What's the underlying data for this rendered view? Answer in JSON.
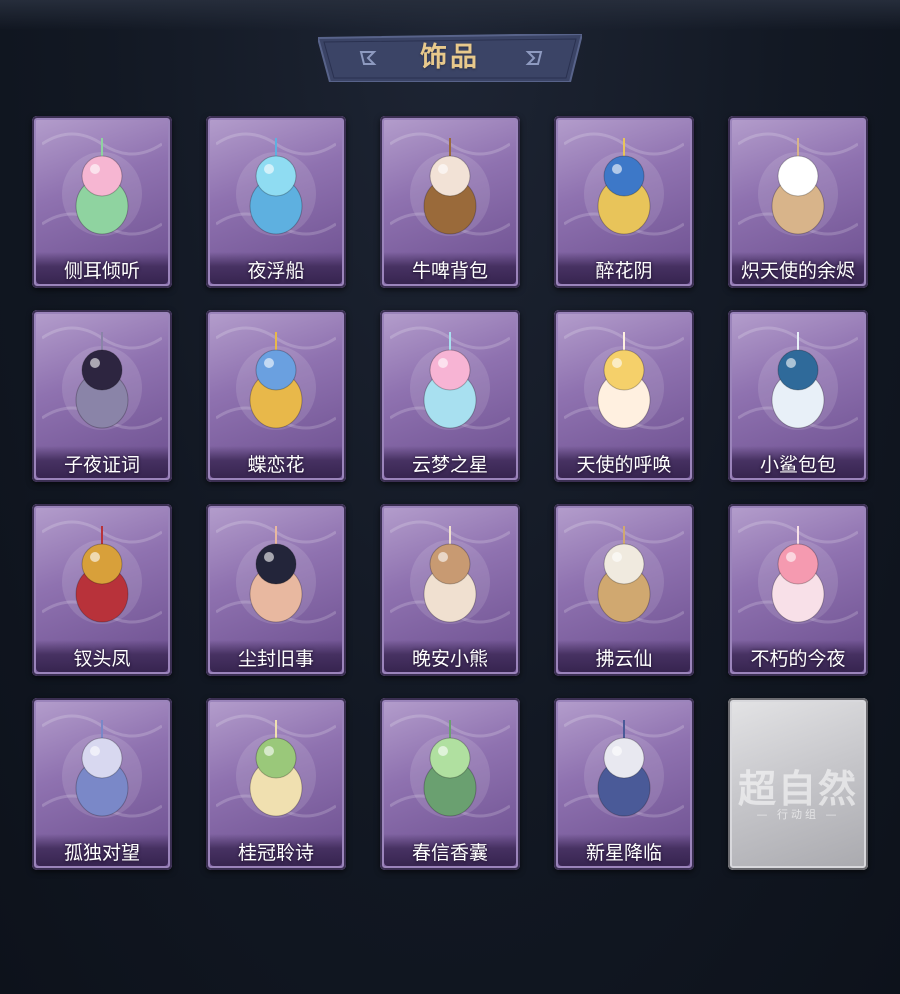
{
  "header": {
    "title": "饰品"
  },
  "colors": {
    "background": "#121823",
    "card_purple": "#8f72b0",
    "card_locked": "#c8c8cc",
    "banner": "#3b4466",
    "title_gold": "#e8c98c"
  },
  "accessories": [
    {
      "name": "侧耳倾听",
      "icon": "lotus-moon-ornament-icon"
    },
    {
      "name": "夜浮船",
      "icon": "jellyfish-ornament-icon"
    },
    {
      "name": "牛啤背包",
      "icon": "cow-beer-mug-icon"
    },
    {
      "name": "醉花阴",
      "icon": "blue-flower-fan-icon"
    },
    {
      "name": "炽天使的余烬",
      "icon": "angel-girl-figure-icon"
    },
    {
      "name": "子夜证词",
      "icon": "owl-plague-doctor-icon"
    },
    {
      "name": "蝶恋花",
      "icon": "butterfly-bell-wreath-icon"
    },
    {
      "name": "云梦之星",
      "icon": "rainbow-unicorn-icon"
    },
    {
      "name": "天使的呼唤",
      "icon": "halo-angel-icon"
    },
    {
      "name": "小鲨包包",
      "icon": "shark-bag-icon"
    },
    {
      "name": "钗头凤",
      "icon": "phoenix-crown-doll-icon"
    },
    {
      "name": "尘封旧事",
      "icon": "gentleman-doll-icon"
    },
    {
      "name": "晚安小熊",
      "icon": "teddy-bear-charm-icon"
    },
    {
      "name": "拂云仙",
      "icon": "white-deity-charm-icon"
    },
    {
      "name": "不朽的今夜",
      "icon": "pink-fox-teacup-icon"
    },
    {
      "name": "孤独对望",
      "icon": "silver-hair-doll-icon"
    },
    {
      "name": "桂冠聆诗",
      "icon": "laurel-poet-charm-icon"
    },
    {
      "name": "春信香囊",
      "icon": "green-sachet-icon"
    },
    {
      "name": "新星降临",
      "icon": "star-boy-charm-icon"
    }
  ],
  "locked_slot": {
    "watermark": "超自然",
    "sub": "— 行动组 —"
  }
}
